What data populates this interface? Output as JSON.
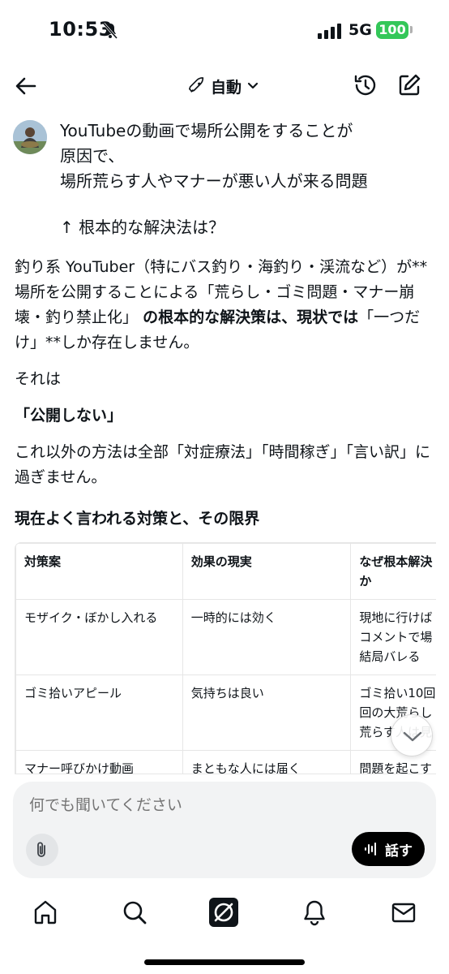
{
  "status_bar": {
    "time": "10:53",
    "network": "5G",
    "battery": "100"
  },
  "header": {
    "mode_label": "自動"
  },
  "user_message": {
    "lines": "YouTubeの動画で場所公開をすることが\n原因で、\n場所荒らす人やマナーが悪い人が来る問題",
    "question": "↑ 根本的な解決法は？"
  },
  "answer": {
    "p1_a": "釣り系 YouTuber（特にバス釣り・海釣り・渓流など）が**場所を公開することによる「荒らし・ゴミ問題・マナー崩壊・釣り禁止化」",
    "p1_b": "の根本的な解決策は、現状では",
    "p1_c": "「一つだけ」**しか存在しません。",
    "p2": "それは",
    "p3": "「公開しない」",
    "p4": "これ以外の方法は全部「対症療法」「時間稼ぎ」「言い訳」に過ぎません。"
  },
  "section_title": "現在よく言われる対策と、その限界",
  "table": {
    "headers": [
      "対策案",
      "効果の現実",
      "なぜ根本解決\nか"
    ],
    "rows": [
      [
        "モザイク・ぼかし入れる",
        "一時的には効く",
        "現地に行けば\nコメントで場\n結局バレる"
      ],
      [
        "ゴミ拾いアピール",
        "気持ちは良い",
        "ゴミ拾い10回\n回の大荒らし\n荒らす人は見"
      ],
      [
        "マナー呼びかけ動画",
        "まともな人には届く",
        "問題を起こす\nびかけなんか"
      ]
    ]
  },
  "composer": {
    "placeholder": "何でも聞いてください",
    "voice_label": "話す"
  },
  "colors": {
    "accent": "#000000",
    "battery": "#34c759",
    "composer_bg": "#f2f3f4"
  },
  "nav": [
    "home-icon",
    "search-icon",
    "grok-icon",
    "bell-icon",
    "mail-icon"
  ]
}
